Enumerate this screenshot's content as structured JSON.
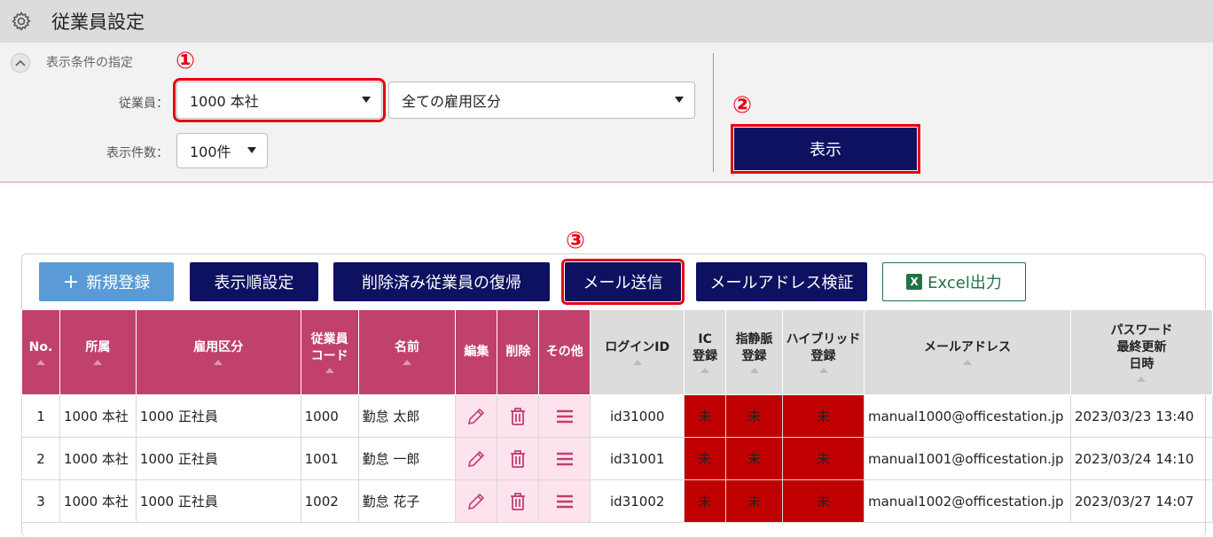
{
  "header": {
    "title": "従業員設定",
    "icon": "gear-icon"
  },
  "filter": {
    "section_label": "表示条件の指定",
    "employee_label": "従業員：",
    "employee_value": "1000 本社",
    "employment_value": "全ての雇用区分",
    "count_label": "表示件数：",
    "count_value": "100件",
    "show_button": "表示"
  },
  "markers": {
    "m1": "①",
    "m2": "②",
    "m3": "③"
  },
  "toolbar": {
    "new": "新規登録",
    "order": "表示順設定",
    "restore": "削除済み従業員の復帰",
    "mail": "メール送信",
    "verify": "メールアドレス検証",
    "excel": "Excel出力",
    "excel_icon_text": "X"
  },
  "table": {
    "headers": {
      "no": "No.",
      "dept": "所属",
      "emptype": "雇用区分",
      "code_l1": "従業員",
      "code_l2": "コード",
      "name": "名前",
      "edit": "編集",
      "delete": "削除",
      "other": "その他",
      "login": "ログインID",
      "ic_l1": "IC",
      "ic_l2": "登録",
      "vein_l1": "指静脈",
      "vein_l2": "登録",
      "hybrid_l1": "ハイブリッド",
      "hybrid_l2": "登録",
      "email": "メールアドレス",
      "pw_l1": "パスワード",
      "pw_l2": "最終更新",
      "pw_l3": "日時"
    },
    "rows": [
      {
        "no": "1",
        "dept": "1000 本社",
        "emptype": "1000 正社員",
        "code": "1000",
        "name": "勤怠 太郎",
        "login": "id31000",
        "ic": "未",
        "vein": "未",
        "hybrid": "未",
        "email": "manual1000@officestation.jp",
        "updated": "2023/03/23 13:40"
      },
      {
        "no": "2",
        "dept": "1000 本社",
        "emptype": "1000 正社員",
        "code": "1001",
        "name": "勤怠 一郎",
        "login": "id31001",
        "ic": "未",
        "vein": "未",
        "hybrid": "未",
        "email": "manual1001@officestation.jp",
        "updated": "2023/03/24 14:10"
      },
      {
        "no": "3",
        "dept": "1000 本社",
        "emptype": "1000 正社員",
        "code": "1002",
        "name": "勤怠 花子",
        "login": "id31002",
        "ic": "未",
        "vein": "未",
        "hybrid": "未",
        "email": "manual1002@officestation.jp",
        "updated": "2023/03/27 14:07"
      }
    ]
  },
  "colors": {
    "navy": "#0e1060",
    "header_pink": "#c0406e",
    "highlight_red": "#e60012",
    "status_red": "#c00000",
    "action_pink": "#fde3ee",
    "new_blue": "#5b9bd5",
    "excel_green": "#217346"
  }
}
